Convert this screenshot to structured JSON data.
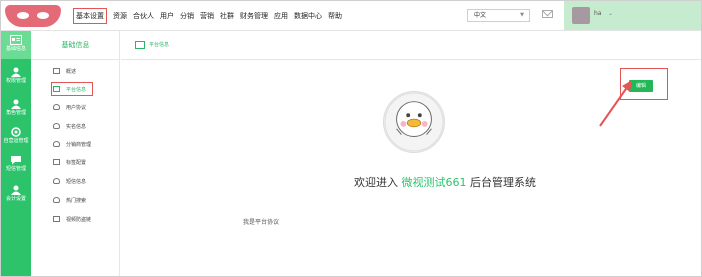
{
  "topnav": {
    "items": [
      "基本设置",
      "资源",
      "合伙人",
      "用户",
      "分销",
      "营销",
      "社群",
      "财务管理",
      "应用",
      "数据中心",
      "帮助"
    ],
    "active_index": 0,
    "language": "中文",
    "username": "ha"
  },
  "sidebar": {
    "items": [
      {
        "label": "基础信息",
        "icon": "id-card-icon"
      },
      {
        "label": "权限管理",
        "icon": "user-icon"
      },
      {
        "label": "角色管理",
        "icon": "user-icon"
      },
      {
        "label": "自营运管理",
        "icon": "gear-icon"
      },
      {
        "label": "短信管理",
        "icon": "chat-icon"
      },
      {
        "label": "会计设置",
        "icon": "user-icon"
      }
    ],
    "active_index": 0
  },
  "submenu": {
    "title": "基础信息",
    "items": [
      {
        "label": "概述",
        "icon": "monitor-icon"
      },
      {
        "label": "平台信息",
        "icon": "monitor-icon"
      },
      {
        "label": "用户协议",
        "icon": "person-icon"
      },
      {
        "label": "实名信息",
        "icon": "person-icon"
      },
      {
        "label": "分销商管理",
        "icon": "person-icon"
      },
      {
        "label": "标签配置",
        "icon": "grid-icon"
      },
      {
        "label": "短信信息",
        "icon": "person-icon"
      },
      {
        "label": "热门搜索",
        "icon": "person-icon"
      },
      {
        "label": "视频防盗链",
        "icon": "monitor-icon"
      }
    ],
    "active_index": 1
  },
  "main": {
    "header_label": "平台信息",
    "edit_button": "编辑",
    "welcome_prefix": "欢迎进入",
    "welcome_highlight": "微视测试661",
    "welcome_suffix": "后台管理系统",
    "agreement_text": "我是平台协议"
  },
  "colors": {
    "brand_green": "#2cc36b",
    "annotation_red": "#e25656"
  }
}
